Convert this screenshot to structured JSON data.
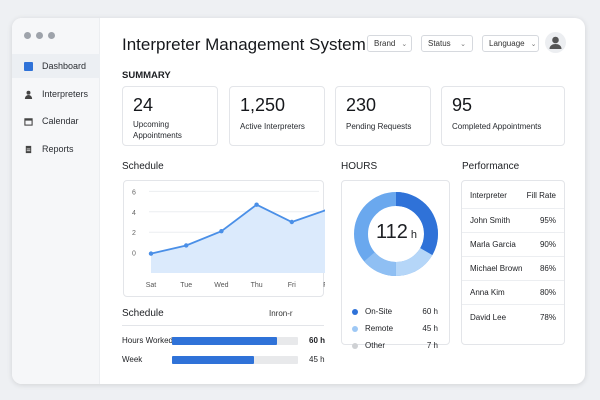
{
  "app": {
    "title": "Interpreter Management System"
  },
  "sidebar": {
    "items": [
      {
        "label": "Dashboard",
        "icon": "dashboard-icon",
        "active": true
      },
      {
        "label": "Interpreters",
        "icon": "person-icon"
      },
      {
        "label": "Calendar",
        "icon": "calendar-icon"
      },
      {
        "label": "Reports",
        "icon": "report-icon"
      }
    ]
  },
  "filters": [
    {
      "label": "Brand"
    },
    {
      "label": "Status"
    },
    {
      "label": "Language"
    }
  ],
  "summary": {
    "title": "SUMMARY",
    "cards": [
      {
        "value": "24",
        "label": "Upcoming Appointments"
      },
      {
        "value": "1,250",
        "label": "Active Interpreters"
      },
      {
        "value": "230",
        "label": "Pending Requests"
      },
      {
        "value": "95",
        "label": "Completed Appointments"
      }
    ]
  },
  "schedule": {
    "title": "Schedule"
  },
  "chart_data": {
    "type": "area",
    "categories": [
      "Sat",
      "Tue",
      "Wed",
      "Thu",
      "Fri",
      "Fx"
    ],
    "values": [
      -0.1,
      0.7,
      2.1,
      4.7,
      3.0,
      4.2
    ],
    "yticks": [
      "0",
      "2",
      "4",
      "6"
    ],
    "ylim": [
      -2,
      6
    ],
    "grid": true,
    "color": "#4a8fe7"
  },
  "schedule2": {
    "title": "Schedule",
    "dropdown": "Inron-r",
    "rows": [
      {
        "label": "Hours Worked",
        "value": "60 h",
        "fill": 0.83
      },
      {
        "label": "Week",
        "value": "45 h",
        "fill": 0.65
      }
    ]
  },
  "hours": {
    "title": "HOURS",
    "total": "112",
    "unit": "h",
    "legend": [
      {
        "label": "On-Site",
        "value": "60 h",
        "color": "#2f72d8"
      },
      {
        "label": "Remote",
        "value": "45 h",
        "color": "#9ec8f5"
      },
      {
        "label": "Other",
        "value": "7 h",
        "color": "#cfd1d4"
      }
    ]
  },
  "performance": {
    "title": "Performance",
    "headers": [
      "Interpreter",
      "Fill Rate"
    ],
    "rows": [
      [
        "John Smith",
        "95%"
      ],
      [
        "Marla Garcia",
        "90%"
      ],
      [
        "Michael Brown",
        "86%"
      ],
      [
        "Anna Kim",
        "80%"
      ],
      [
        "David Lee",
        "78%"
      ]
    ]
  }
}
